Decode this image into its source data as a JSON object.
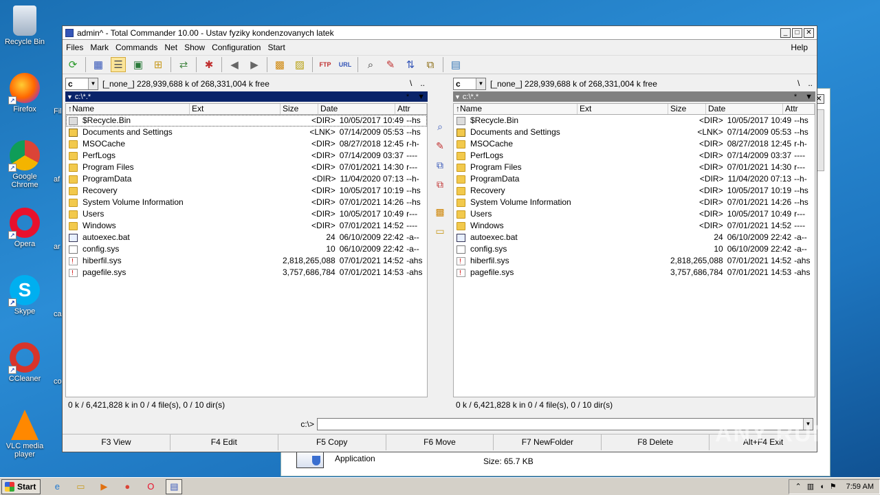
{
  "desktop": {
    "icons": [
      {
        "label": "Recycle Bin",
        "icon": "recycle-bin-icon"
      },
      {
        "label": "Firefox",
        "icon": "firefox-icon"
      },
      {
        "label": "Google Chrome",
        "icon": "chrome-icon"
      },
      {
        "label": "Opera",
        "icon": "opera-icon"
      },
      {
        "label": "Skype",
        "icon": "skype-icon"
      },
      {
        "label": "CCleaner",
        "icon": "ccleaner-icon"
      },
      {
        "label": "VLC media player",
        "icon": "vlc-icon"
      }
    ],
    "partial_labels": [
      "Fil",
      "af",
      "ar",
      "cas",
      "co"
    ]
  },
  "background_window": {
    "app_type": "Application",
    "size_text": "Size: 65.7 KB"
  },
  "window": {
    "title": "admin^ - Total Commander 10.00 - Ustav fyziky kondenzovanych latek",
    "buttons": {
      "minimize": "_",
      "maximize": "□",
      "close": "✕"
    }
  },
  "menu": {
    "items": [
      "Files",
      "Mark",
      "Commands",
      "Net",
      "Show",
      "Configuration",
      "Start"
    ],
    "help": "Help"
  },
  "toolbar": {
    "icons": [
      "refresh-icon",
      "brief-view-icon",
      "detailed-view-icon",
      "thumbnails-icon",
      "tree-icon",
      "invert-selection-icon",
      "select-pointer-icon",
      "back-icon",
      "forward-icon",
      "pack-icon",
      "unpack-icon",
      "ftp-icon",
      "url-icon",
      "search-icon",
      "multi-rename-icon",
      "sync-dirs-icon",
      "compare-icon",
      "notepad-icon"
    ]
  },
  "left_panel": {
    "drive": "c",
    "free_info": "[_none_]  228,939,688 k of 268,331,004 k free",
    "root_buttons": [
      "\\",
      ".."
    ],
    "path": "c:\\*.*",
    "path_extra": [
      "*",
      "▼"
    ],
    "columns": {
      "name": "Name",
      "ext": "Ext",
      "size": "Size",
      "date": "Date",
      "attr": "Attr"
    },
    "status": "0 k / 6,421,828 k in 0 / 4 file(s), 0 / 10 dir(s)"
  },
  "right_panel": {
    "drive": "c",
    "free_info": "[_none_]  228,939,688 k of 268,331,004 k free",
    "root_buttons": [
      "\\",
      ".."
    ],
    "path": "c:\\*.*",
    "path_extra": [
      "*",
      "▼"
    ],
    "columns": {
      "name": "Name",
      "ext": "Ext",
      "size": "Size",
      "date": "Date",
      "attr": "Attr"
    },
    "status": "0 k / 6,421,828 k in 0 / 4 file(s), 0 / 10 dir(s)"
  },
  "files": [
    {
      "name": "$Recycle.Bin",
      "ext": "",
      "size": "<DIR>",
      "date": "10/05/2017 10:49",
      "attr": "--hs",
      "type": "bin"
    },
    {
      "name": "Documents and Settings",
      "ext": "",
      "size": "<LNK>",
      "date": "07/14/2009 05:53",
      "attr": "--hs",
      "type": "lnk"
    },
    {
      "name": "MSOCache",
      "ext": "",
      "size": "<DIR>",
      "date": "08/27/2018 12:45",
      "attr": "r-h-",
      "type": "dir"
    },
    {
      "name": "PerfLogs",
      "ext": "",
      "size": "<DIR>",
      "date": "07/14/2009 03:37",
      "attr": "----",
      "type": "dir"
    },
    {
      "name": "Program Files",
      "ext": "",
      "size": "<DIR>",
      "date": "07/01/2021 14:30",
      "attr": "r---",
      "type": "dir"
    },
    {
      "name": "ProgramData",
      "ext": "",
      "size": "<DIR>",
      "date": "11/04/2020 07:13",
      "attr": "--h-",
      "type": "dir"
    },
    {
      "name": "Recovery",
      "ext": "",
      "size": "<DIR>",
      "date": "10/05/2017 10:19",
      "attr": "--hs",
      "type": "dir"
    },
    {
      "name": "System Volume Information",
      "ext": "",
      "size": "<DIR>",
      "date": "07/01/2021 14:26",
      "attr": "--hs",
      "type": "dir"
    },
    {
      "name": "Users",
      "ext": "",
      "size": "<DIR>",
      "date": "10/05/2017 10:49",
      "attr": "r---",
      "type": "dir"
    },
    {
      "name": "Windows",
      "ext": "",
      "size": "<DIR>",
      "date": "07/01/2021 14:52",
      "attr": "----",
      "type": "dir"
    },
    {
      "name": "autoexec.bat",
      "ext": "",
      "size": "24",
      "date": "06/10/2009 22:42",
      "attr": "-a--",
      "type": "bat"
    },
    {
      "name": "config.sys",
      "ext": "",
      "size": "10",
      "date": "06/10/2009 22:42",
      "attr": "-a--",
      "type": "file"
    },
    {
      "name": "hiberfil.sys",
      "ext": "",
      "size": "2,818,265,088",
      "date": "07/01/2021 14:52",
      "attr": "-ahs",
      "type": "sys"
    },
    {
      "name": "pagefile.sys",
      "ext": "",
      "size": "3,757,686,784",
      "date": "07/01/2021 14:53",
      "attr": "-ahs",
      "type": "sys"
    }
  ],
  "command_line": {
    "path": "c:\\>",
    "value": ""
  },
  "function_keys": [
    "F3 View",
    "F4 Edit",
    "F5 Copy",
    "F6 Move",
    "F7 NewFolder",
    "F8 Delete",
    "Alt+F4 Exit"
  ],
  "watermark": "ANY RUN",
  "taskbar": {
    "start_label": "Start",
    "icons": [
      "ie-icon",
      "explorer-icon",
      "media-player-icon",
      "chrome-icon",
      "opera-icon",
      "total-commander-icon"
    ],
    "time": "7:59 AM"
  },
  "colors": {
    "active_path": "#0a246a",
    "inactive_path": "#808080",
    "folder": "#f2c94c"
  }
}
